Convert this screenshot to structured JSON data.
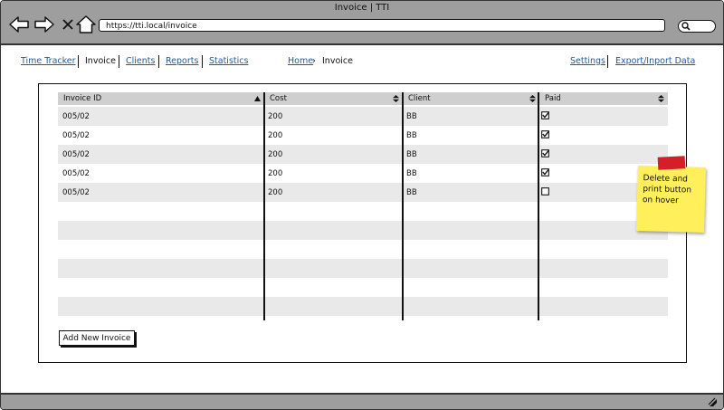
{
  "window": {
    "title": "Invoice | TTI"
  },
  "toolbar": {
    "url": "https://tti.local/invoice",
    "search_placeholder": ""
  },
  "menu": {
    "left": [
      {
        "label": "Time Tracker",
        "link": true
      },
      {
        "label": "Invoice",
        "link": false
      },
      {
        "label": "Clients",
        "link": true
      },
      {
        "label": "Reports",
        "link": true
      },
      {
        "label": "Statistics",
        "link": true
      }
    ],
    "breadcrumb": {
      "home": "Home",
      "separator": "›",
      "current": "Invoice"
    },
    "right": [
      {
        "label": "Settings",
        "link": true
      },
      {
        "label": "Export/Inport Data",
        "link": true
      }
    ]
  },
  "table": {
    "columns": [
      "Invoice ID",
      "Cost",
      "Client",
      "Paid"
    ],
    "rows": [
      {
        "id": "005/02",
        "cost": "200",
        "client": "BB",
        "paid": true
      },
      {
        "id": "005/02",
        "cost": "200",
        "client": "BB",
        "paid": true
      },
      {
        "id": "005/02",
        "cost": "200",
        "client": "BB",
        "paid": true
      },
      {
        "id": "005/02",
        "cost": "200",
        "client": "BB",
        "paid": true
      },
      {
        "id": "005/02",
        "cost": "200",
        "client": "BB",
        "paid": false
      }
    ],
    "empty_rows": 6
  },
  "actions": {
    "add_invoice": "Add New Invoice"
  },
  "note": {
    "text": "Delete and print button on hover"
  }
}
